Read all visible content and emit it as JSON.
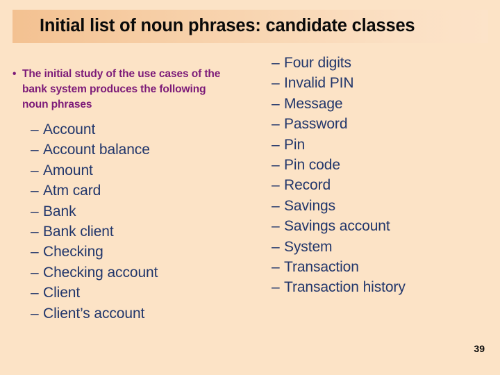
{
  "slide": {
    "title": "Initial list of noun phrases: candidate classes",
    "page_number": "39",
    "background_color": "#fce3c6",
    "title_bar_color": "#f3c191",
    "intro_text_color": "#7c1a78",
    "list_text_color": "#21366b"
  },
  "left_column": {
    "bullet_glyph": "•",
    "intro": "The initial study of the use cases of the bank system produces the following noun phrases",
    "dash_glyph": "–",
    "items": [
      "Account",
      "Account balance",
      "Amount",
      "Atm card",
      "Bank",
      "Bank client",
      "Checking",
      "Checking account",
      "Client",
      "Client’s account"
    ]
  },
  "right_column": {
    "dash_glyph": "–",
    "items": [
      "Four digits",
      "Invalid PIN",
      "Message",
      "Password",
      "Pin",
      "Pin code",
      "Record",
      "Savings",
      "Savings account",
      "System",
      "Transaction",
      "Transaction history"
    ]
  }
}
